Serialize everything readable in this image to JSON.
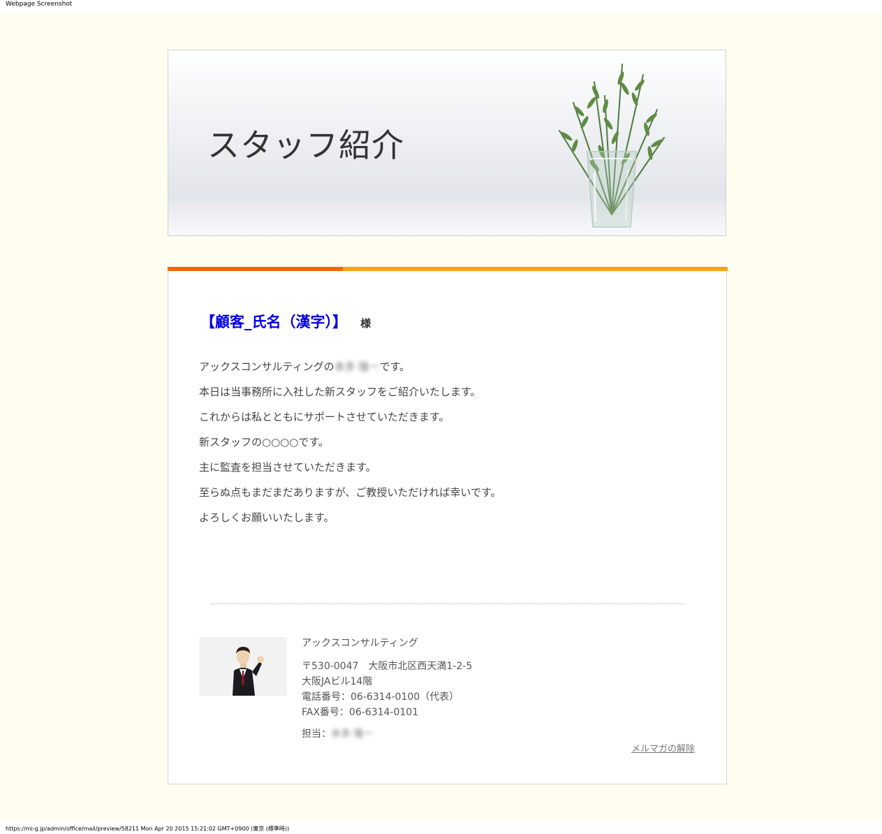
{
  "browser": {
    "header_label": "Webpage Screenshot",
    "footer_text": "https://mi-g.jp/admin/office/mail/preview/58211  Mon Apr 20 2015 15:21:02 GMT+0900 (東京 (標準時))"
  },
  "hero": {
    "title": "スタッフ紹介"
  },
  "email": {
    "greeting_name": "【顧客_氏名（漢字）】",
    "greeting_suffix": "様",
    "sender_name_blurred": "本多 隆一",
    "body": {
      "line1_prefix": "アックスコンサルティングの",
      "line1_suffix": "です。",
      "line2": "本日は当事務所に入社した新スタッフをご紹介いたします。",
      "line3": "これからは私とともにサポートさせていただきます。",
      "line4": "新スタッフの○○○○です。",
      "line5": "主に監査を担当させていただきます。",
      "line6": "至らぬ点もまだまだありますが、ご教授いただければ幸いです。",
      "line7": "よろしくお願いいたします。"
    },
    "signature": {
      "company": "アックスコンサルティング",
      "address1": "〒530-0047　大阪市北区西天満1-2-5",
      "address2": "大阪JAビル14階",
      "phone": "電話番号：06-6314-0100（代表）",
      "fax": "FAX番号：06-6314-0101",
      "contact_label": "担当：",
      "contact_name_blurred": "本多 隆一"
    },
    "unsubscribe": "メルマガの解除"
  },
  "colors": {
    "page_bg": "#fffdf0",
    "stripe_left": "#f26a0a",
    "stripe_right": "#f7a21b",
    "greeting_name": "#0000e6"
  }
}
